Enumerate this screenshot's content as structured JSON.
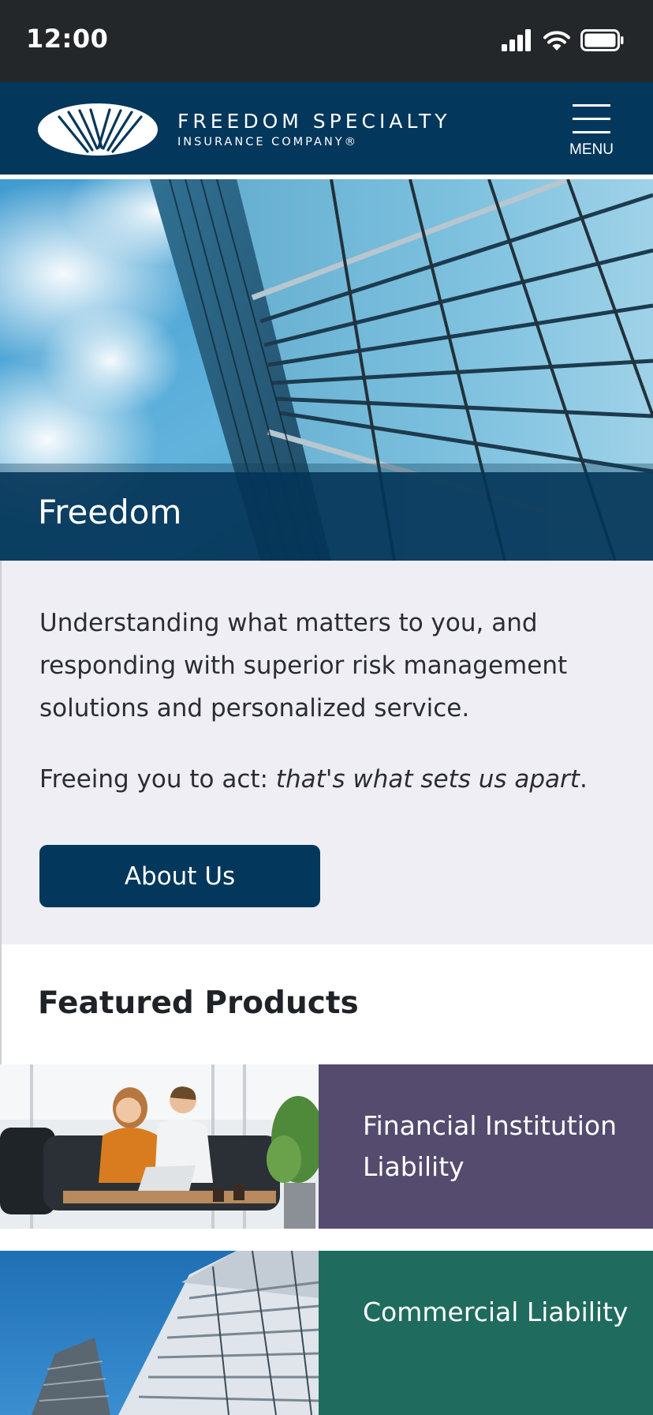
{
  "status_bar": {
    "time": "12:00"
  },
  "header": {
    "brand_line1": "FREEDOM SPECIALTY",
    "brand_line2": "INSURANCE COMPANY®",
    "menu_label": "MENU"
  },
  "hero": {
    "title": "Freedom"
  },
  "intro": {
    "body": "Understanding what matters to you, and responding with superior risk management solutions and personalized service.",
    "tagline_plain": "Freeing you to act: ",
    "tagline_italic": "that's what sets us apart",
    "tagline_end": ".",
    "button_label": "About Us"
  },
  "featured": {
    "heading": "Featured Products",
    "products": [
      {
        "title": "Financial Institution Liability",
        "color": "#544b6e"
      },
      {
        "title": "Commercial Liability",
        "color": "#1f6b5e"
      }
    ]
  },
  "colors": {
    "brand_navy": "#03375b",
    "status_bar": "#242729",
    "intro_bg": "#efeef4"
  }
}
